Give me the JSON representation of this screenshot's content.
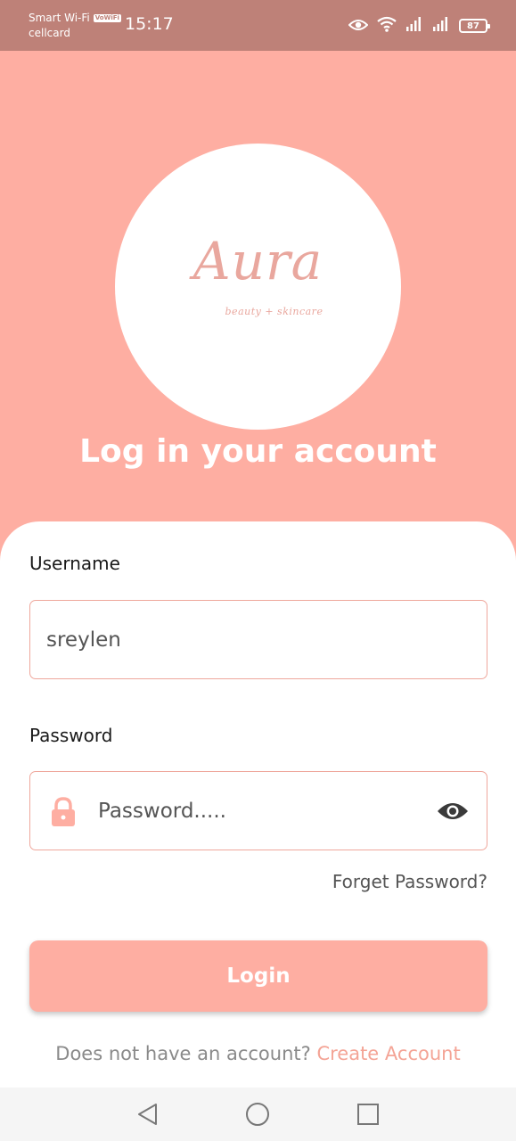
{
  "status_bar": {
    "carrier_line1": "Smart Wi-Fi",
    "vowifi_badge": "VoWiFi",
    "carrier_line2": "cellcard",
    "time": "15:17",
    "battery": "87",
    "icons": [
      "eye-icon",
      "wifi-icon",
      "signal-icon",
      "signal-icon",
      "battery-icon"
    ]
  },
  "logo": {
    "name": "Aura",
    "tagline": "beauty + skincare"
  },
  "headline": "Log in your account",
  "form": {
    "username_label": "Username",
    "username_value": "sreylen",
    "password_label": "Password",
    "password_placeholder": "Password.....",
    "forgot_link": "Forget Password?",
    "login_button": "Login",
    "signup_prompt": "Does not have an account?",
    "signup_link": "Create Account"
  },
  "colors": {
    "brand": "#FEAEA2",
    "status_bar": "#BE8178",
    "field_border": "#EFA79C",
    "link": "#F4A496"
  },
  "nav_bar": {
    "icons": [
      "back-icon",
      "home-icon",
      "recents-icon"
    ]
  }
}
